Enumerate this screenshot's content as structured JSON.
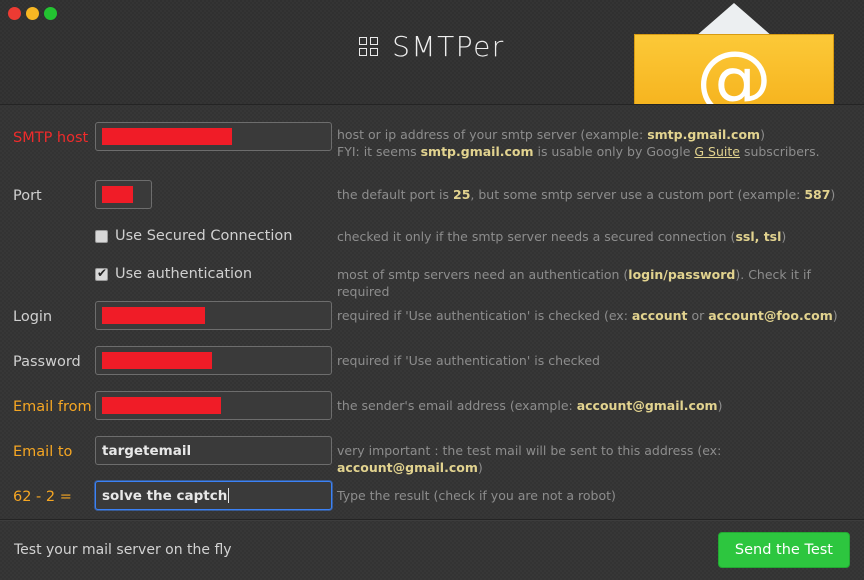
{
  "window": {
    "controls": [
      {
        "name": "close",
        "color": "#ed3b33"
      },
      {
        "name": "minimize",
        "color": "#f7b723"
      },
      {
        "name": "maximize",
        "color": "#23c431"
      }
    ]
  },
  "header": {
    "brand": "SMTPer",
    "logo_icon": "grid-2x2-icon",
    "envelope_icon": "envelope-at-icon",
    "at_glyph": "@"
  },
  "form": {
    "rows": [
      {
        "id": "smtp-host",
        "label": "SMTP host",
        "label_color": "#ef2b2b",
        "value": "",
        "redacted": true,
        "redact_width": 130,
        "help_html": "host or ip address of your smtp server (example: <b>smtp.gmail.com</b>)<br>FYI: it seems <b>smtp.gmail.com</b> is usable only by Google <u>G Suite</u> subscribers."
      },
      {
        "id": "port",
        "label": "Port",
        "label_color": "#d0d0d0",
        "value": "",
        "redacted": true,
        "redact_width": 31,
        "help_html": "the default port is <b>25</b>, but some smtp server use a custom port (example: <b>587</b>)"
      },
      {
        "id": "use-secured-connection",
        "type": "checkbox",
        "label": "Use Secured Connection",
        "checked": false,
        "help_html": "checked it only if the smtp server needs a secured connection (<b>ssl, tsl</b>)"
      },
      {
        "id": "use-authentication",
        "type": "checkbox",
        "label": "Use authentication",
        "checked": true,
        "help_html": "most of smtp servers need an authentication (<b>login/password</b>). Check it if required"
      },
      {
        "id": "login",
        "label": "Login",
        "label_color": "#d0d0d0",
        "value": "",
        "redacted": true,
        "redact_width": 103,
        "help_html": "required if 'Use authentication' is checked (ex: <b>account</b> or <b>account@foo.com</b>)"
      },
      {
        "id": "password",
        "label": "Password",
        "label_color": "#d0d0d0",
        "value": "",
        "redacted": true,
        "redact_width": 110,
        "help_html": "required if 'Use authentication' is checked"
      },
      {
        "id": "email-from",
        "label": "Email from",
        "label_color": "#f5a623",
        "value": "",
        "redacted": true,
        "redact_width": 119,
        "help_html": "the sender's email address (example: <b>account@gmail.com</b>)"
      },
      {
        "id": "email-to",
        "label": "Email to",
        "label_color": "#f5a623",
        "value": "targetemail",
        "redacted": false,
        "help_html": "very important : the test mail will be sent to this address (ex: <b>account@gmail.com</b>)"
      },
      {
        "id": "captcha",
        "label": "62 - 2 =",
        "label_color": "#f5a623",
        "value": "solve the captch",
        "redacted": false,
        "focused": true,
        "help_html": "Type the result (check if you are not a robot)"
      }
    ]
  },
  "footer": {
    "tagline": "Test your mail server on the fly",
    "send_label": "Send the Test",
    "send_color": "#2dc63f"
  }
}
